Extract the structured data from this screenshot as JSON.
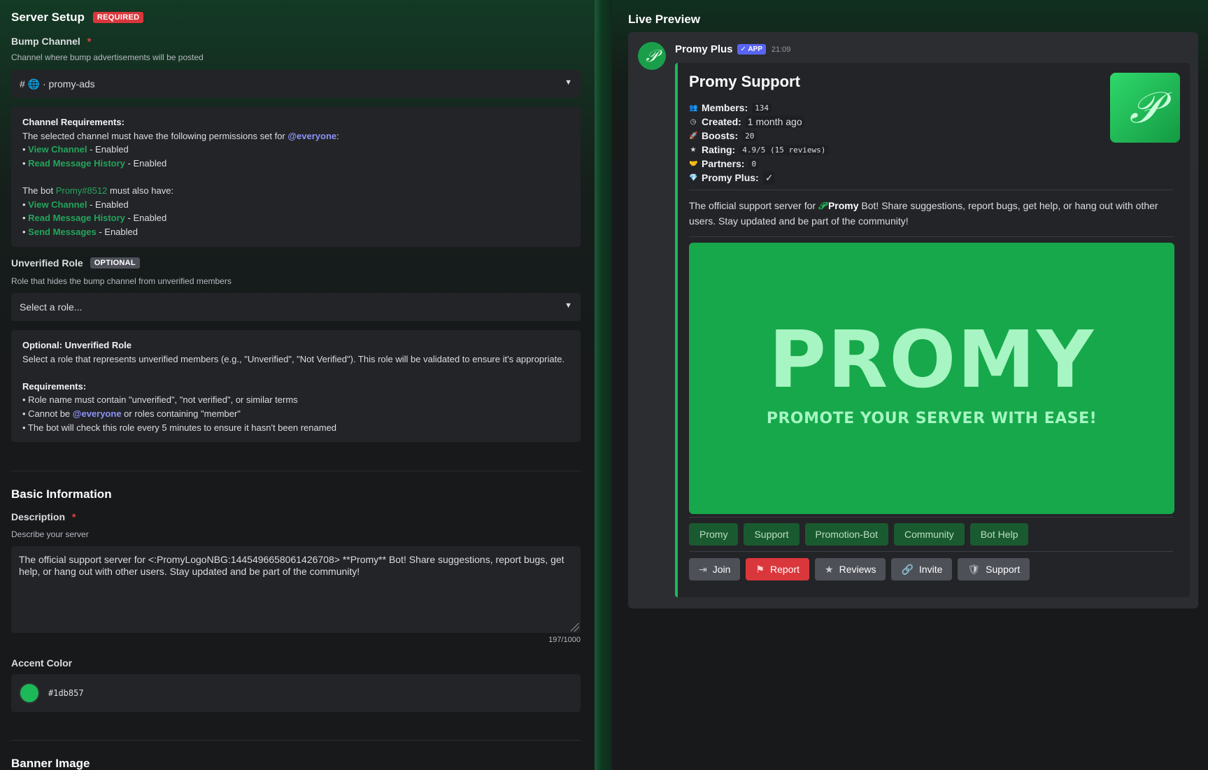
{
  "left": {
    "server_setup": {
      "title": "Server Setup",
      "badge": "REQUIRED"
    },
    "bump_channel": {
      "label": "Bump Channel",
      "required_mark": "*",
      "hint": "Channel where bump advertisements will be posted",
      "selected": "# 🌐 · promy-ads"
    },
    "channel_requirements": {
      "title": "Channel Requirements:",
      "intro": "The selected channel must have the following permissions set for ",
      "everyone": "@everyone",
      "colon": ":",
      "perm1": "View Channel",
      "perm2": "Read Message History",
      "enabled": " - Enabled",
      "bullet": "• ",
      "bot_intro": "The bot ",
      "bot_name": "Promy#8512",
      "bot_suffix": " must also have:",
      "perm3": "View Channel",
      "perm4": "Read Message History",
      "perm5": "Send Messages"
    },
    "unverified_role": {
      "label": "Unverified Role",
      "badge": "OPTIONAL",
      "hint": "Role that hides the bump channel from unverified members",
      "placeholder": "Select a role..."
    },
    "optional_box": {
      "title": "Optional: Unverified Role",
      "text": "Select a role that represents unverified members (e.g., \"Unverified\", \"Not Verified\"). This role will be validated to ensure it's appropriate.",
      "req_title": "Requirements:",
      "req1": "• Role name must contain \"unverified\", \"not verified\", or similar terms",
      "req2_pre": "• Cannot be ",
      "req2_mention": "@everyone",
      "req2_post": " or roles containing \"member\"",
      "req3": "• The bot will check this role every 5 minutes to ensure it hasn't been renamed"
    },
    "basic_info": {
      "title": "Basic Information"
    },
    "description": {
      "label": "Description",
      "required_mark": "*",
      "hint": "Describe your server",
      "value": "The official support server for <:PromyLogoNBG:1445496658061426708> **Promy** Bot! Share suggestions, report bugs, get help, or hang out with other users. Stay updated and be part of the community!",
      "counter": "197/1000"
    },
    "accent": {
      "label": "Accent Color",
      "value": "#1db857"
    },
    "banner": {
      "label": "Banner Image"
    }
  },
  "right": {
    "title": "Live Preview",
    "bot_name": "Promy Plus",
    "app_badge": "✓ APP",
    "time": "21:09",
    "embed": {
      "title": "Promy Support",
      "stats": [
        {
          "label": "Members:",
          "value": "134",
          "icon": "users-icon",
          "glyph": "👥",
          "code": true
        },
        {
          "label": "Created:",
          "value": "1 month ago",
          "icon": "clock-icon",
          "glyph": "◷",
          "code": false
        },
        {
          "label": "Boosts:",
          "value": "20",
          "icon": "rocket-icon",
          "glyph": "🚀",
          "code": true
        },
        {
          "label": "Rating:",
          "value": "4.9/5 (15 reviews)",
          "icon": "star-icon",
          "glyph": "★",
          "code": true
        },
        {
          "label": "Partners:",
          "value": "0",
          "icon": "handshake-icon",
          "glyph": "🤝",
          "code": true
        },
        {
          "label": "Promy Plus:",
          "value": "✓",
          "icon": "gem-icon",
          "glyph": "💎",
          "code": false
        }
      ],
      "desc_pre": "The official support server for ",
      "desc_bold": "Promy",
      "desc_post": " Bot! Share suggestions, report bugs, get help, or hang out with other users. Stay updated and be part of the community!",
      "banner_big": "PROMY",
      "banner_small": "PROMOTE YOUR SERVER WITH EASE!",
      "tags": [
        "Promy",
        "Support",
        "Promotion-Bot",
        "Community",
        "Bot Help"
      ],
      "buttons": [
        {
          "label": "Join",
          "icon": "enter-icon",
          "glyph": "⇥",
          "style": "secondary"
        },
        {
          "label": "Report",
          "icon": "flag-icon",
          "glyph": "⚑",
          "style": "danger"
        },
        {
          "label": "Reviews",
          "icon": "star-icon",
          "glyph": "★",
          "style": "secondary"
        },
        {
          "label": "Invite",
          "icon": "link-icon",
          "glyph": "🔗",
          "style": "secondary"
        },
        {
          "label": "Support",
          "icon": "shield-icon",
          "glyph": "🛡",
          "style": "secondary"
        }
      ]
    }
  },
  "colors": {
    "accent": "#1db857",
    "danger": "#da373c",
    "mention": "#8c93f6",
    "permission": "#23a55a"
  }
}
